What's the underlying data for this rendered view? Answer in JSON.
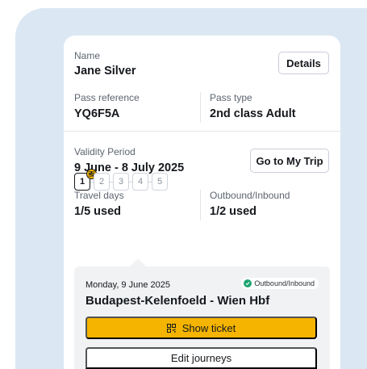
{
  "pass": {
    "name_label": "Name",
    "name_value": "Jane Silver",
    "details_button": "Details",
    "reference_label": "Pass reference",
    "reference_value": "YQ6F5A",
    "type_label": "Pass type",
    "type_value": "2nd class Adult"
  },
  "validity": {
    "label": "Validity Period",
    "value": "9 June - 8 July 2025",
    "trip_button": "Go to My Trip"
  },
  "usage": {
    "travel_days_label": "Travel days",
    "travel_days_value": "1/5 used",
    "outbound_label": "Outbound/Inbound",
    "outbound_value": "1/2 used"
  },
  "days": [
    "1",
    "2",
    "3",
    "4",
    "5"
  ],
  "journey": {
    "date": "Monday, 9 June 2025",
    "status": "Outbound/Inbound",
    "route": "Budapest-Kelenfoeld - Wien Hbf",
    "show_ticket": "Show ticket",
    "edit_journeys": "Edit journeys"
  },
  "colors": {
    "backdrop": "#dbe8f3",
    "accent": "#f4b400",
    "status_green": "#1fa672"
  },
  "icons": {
    "day_badge": "qr-code-icon",
    "status": "check-circle-icon",
    "ticket": "qr-code-icon"
  }
}
